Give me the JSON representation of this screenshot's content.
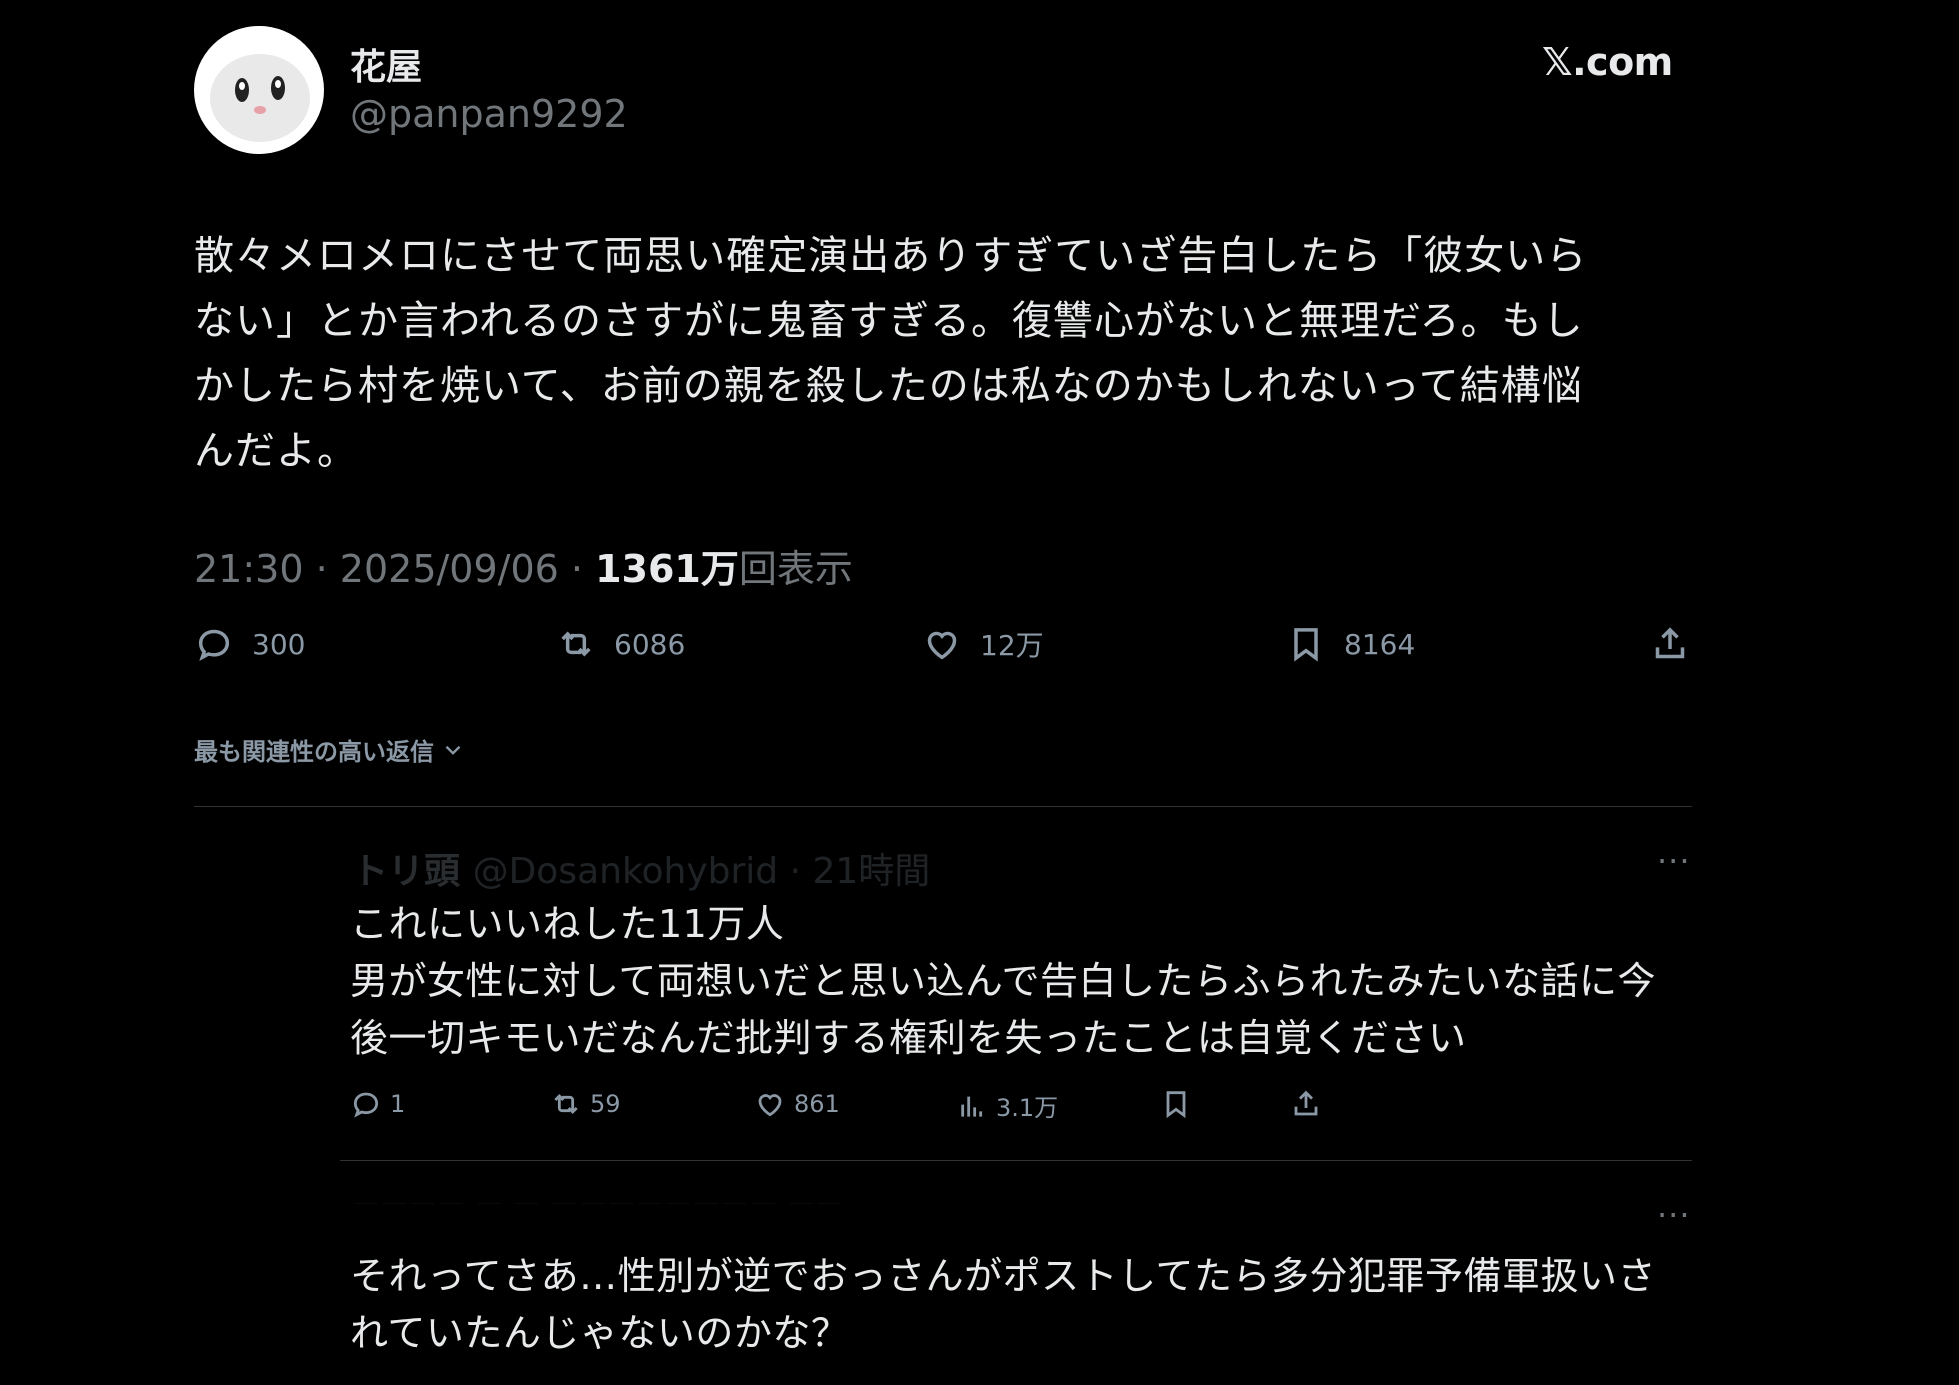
{
  "author": {
    "display_name": "花屋",
    "handle": "@panpan9292"
  },
  "brand": "𝕏.com",
  "tweet": {
    "text": "散々メロメロにさせて両思い確定演出ありすぎていざ告白したら「彼女いら\nない」とか言われるのさすがに鬼畜すぎる。復讐心がないと無理だろ。もし\nかしたら村を焼いて、お前の親を殺したのは私なのかもしれないって結構悩\nんだよ。",
    "time": "21:30",
    "date": "2025/09/06",
    "separator": "·",
    "views_count": "1361万",
    "views_label": "回表示"
  },
  "actions": {
    "replies": "300",
    "retweets": "6086",
    "likes": "12万",
    "bookmarks": "8164"
  },
  "sort_label": "最も関連性の高い返信",
  "replies": [
    {
      "header_name": "トリ頭",
      "header_meta": "@Dosankohybrid · 21時間",
      "text": "これにいいねした11万人\n男が女性に対して両想いだと思い込んで告白したらふられたみたいな話に今\n後一切キモいだなんだ批判する権利を失ったことは自覚ください",
      "replies": "1",
      "retweets": "59",
      "likes": "861",
      "views": "3.1万",
      "more": "···"
    },
    {
      "text": "それってさあ…性別が逆でおっさんがポストしてたら多分犯罪予備軍扱いさ\nれていたんじゃないのかな？",
      "more": "···"
    }
  ],
  "icons": [
    "reply-icon",
    "retweet-icon",
    "like-icon",
    "bookmark-icon",
    "share-icon",
    "chevron-down-icon",
    "views-icon",
    "more-icon",
    "avatar"
  ]
}
